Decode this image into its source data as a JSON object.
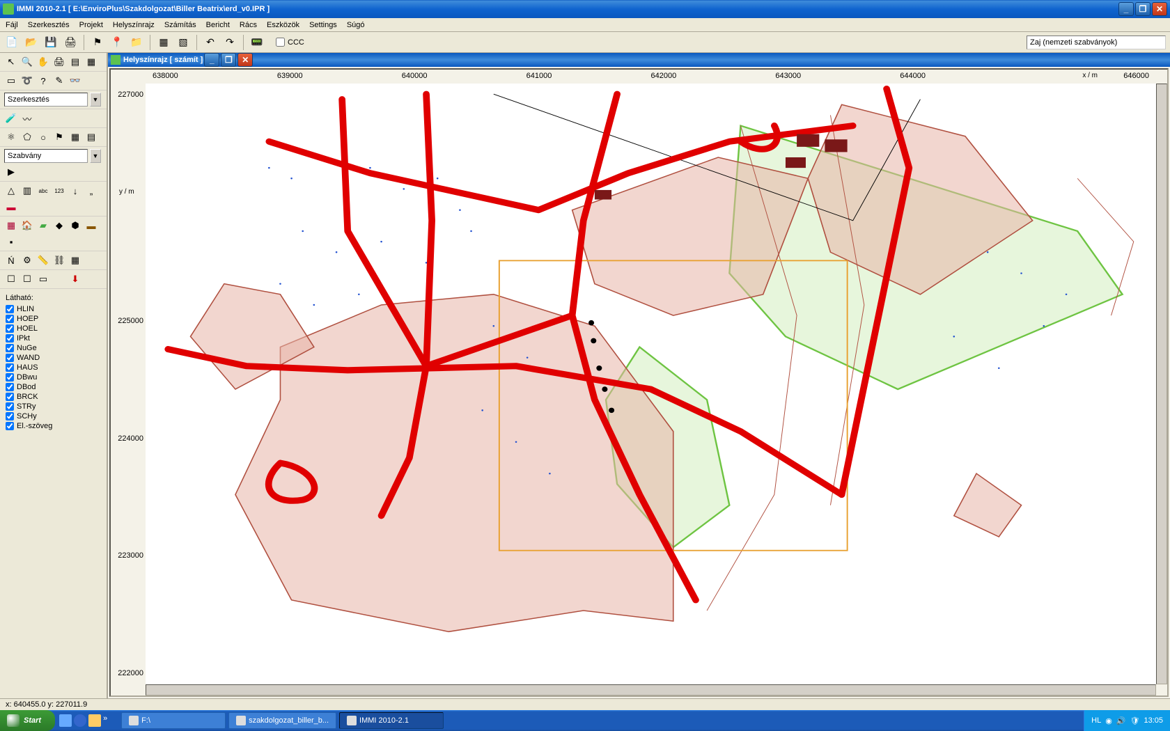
{
  "app": {
    "title": "IMMI 2010-2.1  [  E:\\EnviroPlus\\Szakdolgozat\\Biller Beatrix\\erd_v0.IPR  ]",
    "mode": "Zaj (nemzeti szabványok)"
  },
  "menu": [
    "Fájl",
    "Szerkesztés",
    "Projekt",
    "Helyszínrajz",
    "Számítás",
    "Bericht",
    "Rács",
    "Eszközök",
    "Settings",
    "Súgó"
  ],
  "ccc_label": "CCC",
  "panel": {
    "szerk": "Szerkesztés",
    "szabv": "Szabvány"
  },
  "layers_header": "Látható:",
  "layers": [
    "HLIN",
    "HOEP",
    "HOEL",
    "IPkt",
    "NuGe",
    "WAND",
    "HAUS",
    "DBwu",
    "DBod",
    "BRCK",
    "STRy",
    "SCHy",
    "El.-szöveg"
  ],
  "mapwin": {
    "title": "Helyszínrajz  [ számít ]"
  },
  "axes": {
    "x_label": "x / m",
    "y_label": "y / m",
    "x_ticks": [
      "638000",
      "639000",
      "640000",
      "641000",
      "642000",
      "643000",
      "644000",
      "",
      "646000"
    ],
    "y_ticks": [
      "227000",
      "",
      "225000",
      "224000",
      "223000",
      "222000"
    ]
  },
  "status": "x: 640455.0  y: 227011.9",
  "taskbar": {
    "start": "Start",
    "tasks": [
      {
        "label": "F:\\",
        "active": false
      },
      {
        "label": "szakdolgozat_biller_b...",
        "active": false
      },
      {
        "label": "IMMI 2010-2.1",
        "active": true
      }
    ],
    "lang": "HL",
    "clock": "13:05"
  },
  "chart_data": {
    "type": "map",
    "title": "Helyszínrajz",
    "xlabel": "x / m",
    "ylabel": "y / m",
    "xlim": [
      637500,
      646500
    ],
    "ylim": [
      221500,
      227200
    ],
    "coord_system": "local projected (m)",
    "selection_rect": {
      "xmin": 640650,
      "ymin": 222770,
      "xmax": 643750,
      "ymax": 225520
    },
    "layers_visible": [
      "HLIN",
      "HOEP",
      "HOEL",
      "IPkt",
      "NuGe",
      "WAND",
      "HAUS",
      "DBwu",
      "DBod",
      "BRCK",
      "STRy",
      "SCHy",
      "El.-szöveg"
    ],
    "roads_major_polyline": [
      [
        [
          637700,
          224680
        ],
        [
          638400,
          224520
        ],
        [
          639300,
          224480
        ],
        [
          640800,
          224520
        ],
        [
          642000,
          224300
        ],
        [
          642800,
          223900
        ],
        [
          643700,
          223300
        ],
        [
          644300,
          226400
        ],
        [
          644100,
          227150
        ]
      ],
      [
        [
          640000,
          227100
        ],
        [
          640050,
          225900
        ],
        [
          640000,
          224520
        ],
        [
          639850,
          223650
        ],
        [
          639600,
          223100
        ]
      ],
      [
        [
          639250,
          227050
        ],
        [
          639300,
          225800
        ],
        [
          640000,
          224520
        ]
      ],
      [
        [
          641700,
          227100
        ],
        [
          641400,
          225900
        ],
        [
          641300,
          225000
        ],
        [
          641500,
          224200
        ],
        [
          641900,
          223300
        ],
        [
          642400,
          222300
        ]
      ],
      [
        [
          638600,
          226650
        ],
        [
          639500,
          226350
        ],
        [
          641000,
          226000
        ],
        [
          641800,
          226350
        ],
        [
          642700,
          226650
        ],
        [
          643800,
          226800
        ]
      ]
    ],
    "landuse_polygons": {
      "built_filled": "salmon-hatch polygons central-south",
      "green_hatch": "vegetation/forest strips east & center",
      "blue_points": "scattered point features northwest & east edges"
    },
    "status_cursor": {
      "x": 640455.0,
      "y": 227011.9
    }
  }
}
